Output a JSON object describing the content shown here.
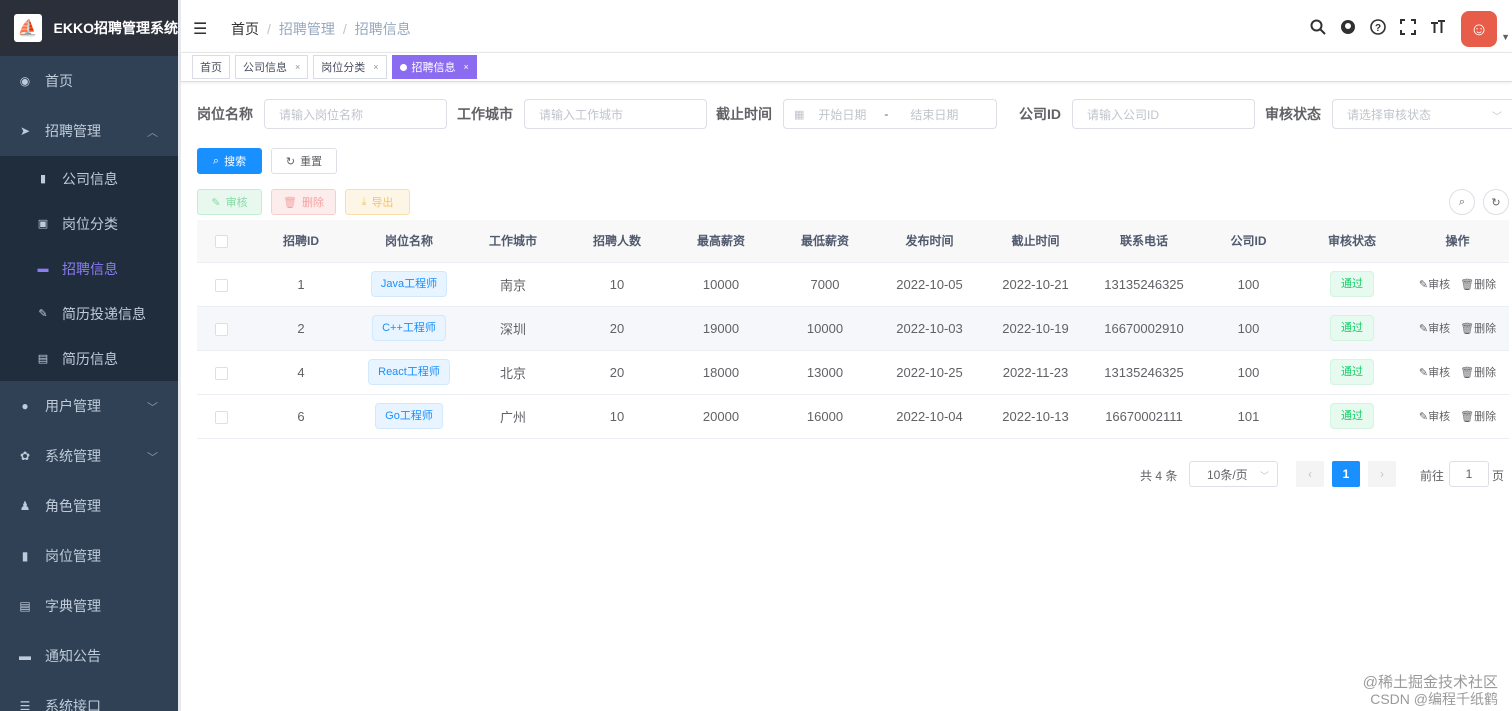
{
  "app": {
    "title": "EKKO招聘管理系统"
  },
  "sidebar": {
    "items": [
      {
        "label": "首页",
        "icon": "dashboard-icon"
      },
      {
        "label": "招聘管理",
        "icon": "send-icon",
        "expanded": true,
        "children": [
          {
            "label": "公司信息",
            "icon": "building-icon"
          },
          {
            "label": "岗位分类",
            "icon": "category-icon"
          },
          {
            "label": "招聘信息",
            "icon": "message-icon",
            "active": true
          },
          {
            "label": "简历投递信息",
            "icon": "edit-icon"
          },
          {
            "label": "简历信息",
            "icon": "document-icon"
          }
        ]
      },
      {
        "label": "用户管理",
        "icon": "user-icon"
      },
      {
        "label": "系统管理",
        "icon": "gear-icon"
      },
      {
        "label": "角色管理",
        "icon": "role-icon"
      },
      {
        "label": "岗位管理",
        "icon": "post-icon"
      },
      {
        "label": "字典管理",
        "icon": "dict-icon"
      },
      {
        "label": "通知公告",
        "icon": "notice-icon"
      },
      {
        "label": "系统接口",
        "icon": "api-icon"
      }
    ]
  },
  "breadcrumb": [
    "首页",
    "招聘管理",
    "招聘信息"
  ],
  "tags": [
    {
      "label": "首页"
    },
    {
      "label": "公司信息",
      "close": "×"
    },
    {
      "label": "岗位分类",
      "close": "×"
    },
    {
      "label": "招聘信息",
      "close": "×",
      "active": true
    }
  ],
  "search": {
    "job_name_label": "岗位名称",
    "job_name_placeholder": "请输入岗位名称",
    "city_label": "工作城市",
    "city_placeholder": "请输入工作城市",
    "deadline_label": "截止时间",
    "start_placeholder": "开始日期",
    "range_sep": "-",
    "end_placeholder": "结束日期",
    "company_label": "公司ID",
    "company_placeholder": "请输入公司ID",
    "status_label": "审核状态",
    "status_placeholder": "请选择审核状态",
    "search_btn": "搜索",
    "reset_btn": "重置"
  },
  "toolbar": {
    "audit": "审核",
    "delete": "删除",
    "export": "导出"
  },
  "table": {
    "columns": [
      "招聘ID",
      "岗位名称",
      "工作城市",
      "招聘人数",
      "最高薪资",
      "最低薪资",
      "发布时间",
      "截止时间",
      "联系电话",
      "公司ID",
      "审核状态",
      "操作"
    ],
    "op_audit": "审核",
    "op_delete": "删除",
    "rows": [
      {
        "id": "1",
        "name": "Java工程师",
        "city": "南京",
        "count": "10",
        "max": "10000",
        "min": "7000",
        "publish": "2022-10-05",
        "deadline": "2022-10-21",
        "phone": "13135246325",
        "company": "100",
        "status": "通过"
      },
      {
        "id": "2",
        "name": "C++工程师",
        "city": "深圳",
        "count": "20",
        "max": "19000",
        "min": "10000",
        "publish": "2022-10-03",
        "deadline": "2022-10-19",
        "phone": "16670002910",
        "company": "100",
        "status": "通过"
      },
      {
        "id": "4",
        "name": "React工程师",
        "city": "北京",
        "count": "20",
        "max": "18000",
        "min": "13000",
        "publish": "2022-10-25",
        "deadline": "2022-11-23",
        "phone": "13135246325",
        "company": "100",
        "status": "通过"
      },
      {
        "id": "6",
        "name": "Go工程师",
        "city": "广州",
        "count": "10",
        "max": "20000",
        "min": "16000",
        "publish": "2022-10-04",
        "deadline": "2022-10-13",
        "phone": "16670002111",
        "company": "101",
        "status": "通过"
      }
    ]
  },
  "pagination": {
    "total": "共 4 条",
    "page_size": "10条/页",
    "current": "1",
    "goto": "前往",
    "goto_value": "1",
    "page_unit": "页"
  },
  "watermark": {
    "line1": "@稀土掘金技术社区",
    "line2": "CSDN @编程千纸鹤"
  },
  "colors": {
    "sidebar_bg": "#304156",
    "accent": "#1890ff",
    "active_menu": "#8b7cf6"
  }
}
